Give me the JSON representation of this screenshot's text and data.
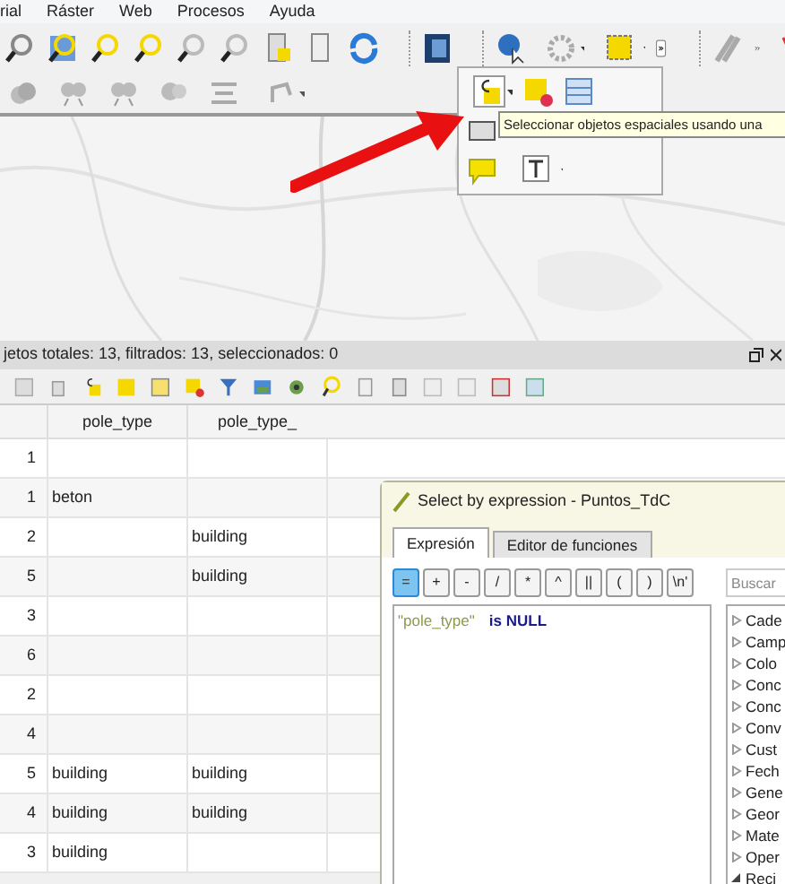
{
  "menu": [
    {
      "label": "rial"
    },
    {
      "label": "Ráster"
    },
    {
      "label": "Web"
    },
    {
      "label": "Procesos"
    },
    {
      "label": "Ayuda"
    }
  ],
  "tooltip": "Seleccionar objetos espaciales usando una",
  "attribute_table": {
    "status": "jetos totales: 13, filtrados: 13, seleccionados: 0",
    "columns": [
      "pole_type",
      "pole_type_"
    ],
    "rows": [
      {
        "number": "1"
      },
      {
        "number": "1",
        "cells": [
          "beton",
          null
        ]
      },
      {
        "number": "2",
        "cells": [
          null,
          "building"
        ]
      },
      {
        "number": "5",
        "cells": [
          null,
          "building"
        ]
      },
      {
        "number": "3"
      },
      {
        "number": "6"
      },
      {
        "number": "2"
      },
      {
        "number": "4"
      },
      {
        "number": "5",
        "cells": [
          "building",
          "building"
        ]
      },
      {
        "number": "4",
        "cells": [
          "building",
          "building"
        ]
      },
      {
        "number": "3",
        "cells": [
          "building",
          null
        ]
      }
    ]
  },
  "dialog": {
    "title": "Select by expression - Puntos_TdC",
    "tabs": [
      {
        "label": "Expresión",
        "selected": true
      },
      {
        "label": "Editor de funciones",
        "selected": false
      }
    ],
    "operators": [
      {
        "label": "=",
        "selected": true
      },
      {
        "label": "+",
        "selected": false
      },
      {
        "label": "-",
        "selected": false
      },
      {
        "label": "/",
        "selected": false
      },
      {
        "label": "*",
        "selected": false
      },
      {
        "label": "^",
        "selected": false
      },
      {
        "label": "||",
        "selected": false
      },
      {
        "label": "(",
        "selected": false
      },
      {
        "label": ")",
        "selected": false
      },
      {
        "label": "\\n'",
        "selected": false
      }
    ],
    "expression": {
      "field": "\"pole_type\"",
      "keyword": "is NULL"
    },
    "search": {
      "placeholder": "Buscar"
    },
    "groups": [
      {
        "label": "Cade",
        "expanded": false
      },
      {
        "label": "Camp",
        "expanded": false
      },
      {
        "label": "Colo",
        "expanded": false
      },
      {
        "label": "Conc",
        "expanded": false
      },
      {
        "label": "Conc",
        "expanded": false
      },
      {
        "label": "Conv",
        "expanded": false
      },
      {
        "label": "Cust",
        "expanded": false
      },
      {
        "label": "Fech",
        "expanded": false
      },
      {
        "label": "Gene",
        "expanded": false
      },
      {
        "label": "Geor",
        "expanded": false
      },
      {
        "label": "Mate",
        "expanded": false
      },
      {
        "label": "Oper",
        "expanded": false
      },
      {
        "label": "Reci",
        "expanded": true
      }
    ]
  }
}
